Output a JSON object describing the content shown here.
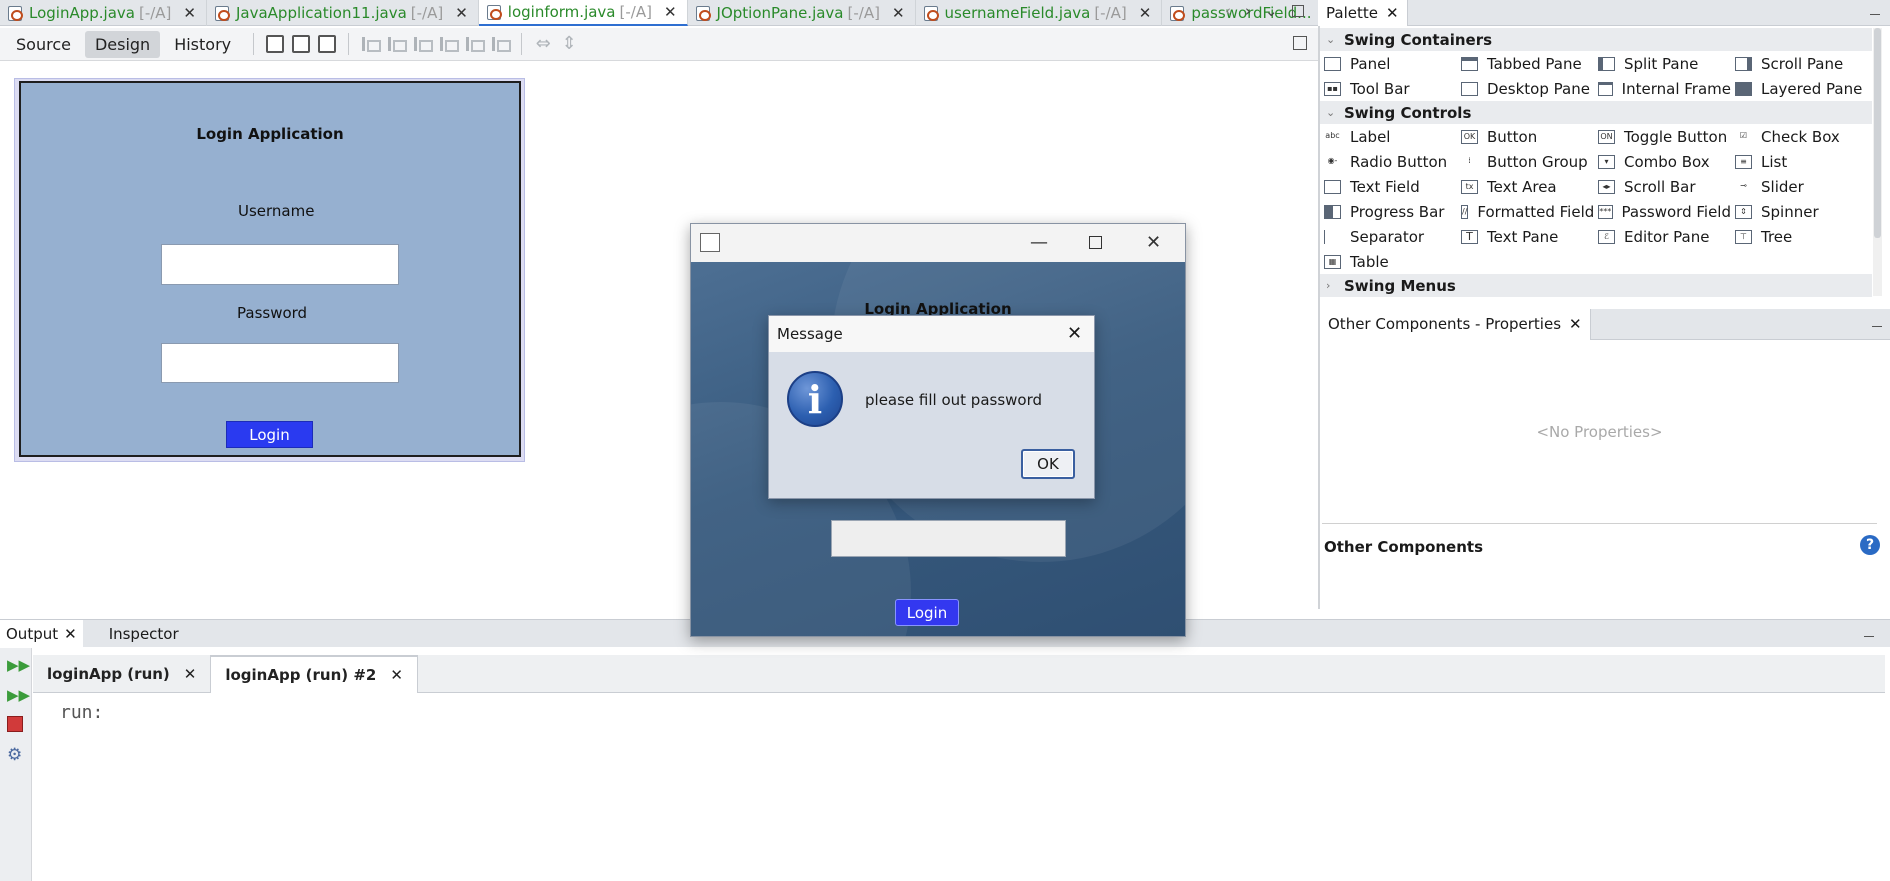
{
  "editor_tabs": [
    {
      "name": "LoginApp.java",
      "path": "[-/A]",
      "active": false
    },
    {
      "name": "JavaApplication11.java",
      "path": "[-/A]",
      "active": false
    },
    {
      "name": "loginform.java",
      "path": "[-/A]",
      "active": true
    },
    {
      "name": "JOptionPane.java",
      "path": "[-/A]",
      "active": false
    },
    {
      "name": "usernameField.java",
      "path": "[-/A]",
      "active": false
    },
    {
      "name": "passwordField...",
      "path": "",
      "active": false
    }
  ],
  "editor_toolbar": {
    "source": "Source",
    "design": "Design",
    "history": "History"
  },
  "design_form": {
    "title": "Login Application",
    "username_label": "Username",
    "password_label": "Password",
    "login_button": "Login"
  },
  "palette": {
    "tab_title": "Palette",
    "categories": [
      {
        "label": "Swing Containers",
        "items": [
          "Panel",
          "Tabbed Pane",
          "Split Pane",
          "Scroll Pane",
          "Tool Bar",
          "Desktop Pane",
          "Internal Frame",
          "Layered Pane"
        ]
      },
      {
        "label": "Swing Controls",
        "items": [
          "Label",
          "Button",
          "Toggle Button",
          "Check Box",
          "Radio Button",
          "Button Group",
          "Combo Box",
          "List",
          "Text Field",
          "Text Area",
          "Scroll Bar",
          "Slider",
          "Progress Bar",
          "Formatted Field",
          "Password Field",
          "Spinner",
          "Separator",
          "Text Pane",
          "Editor Pane",
          "Tree",
          "Table"
        ]
      },
      {
        "label": "Swing Menus",
        "items": []
      }
    ]
  },
  "properties": {
    "tab_title": "Other Components - Properties",
    "empty_text": "<No Properties>",
    "section_title": "Other Components"
  },
  "output": {
    "tabs": [
      "Output",
      "Inspector"
    ],
    "run_tabs": [
      "loginApp (run)",
      "loginApp (run) #2"
    ],
    "console": "run:"
  },
  "running_app": {
    "title_partial": "Login Application",
    "login_button": "Login"
  },
  "dialog": {
    "title": "Message",
    "message": "please fill out password",
    "ok": "OK"
  }
}
